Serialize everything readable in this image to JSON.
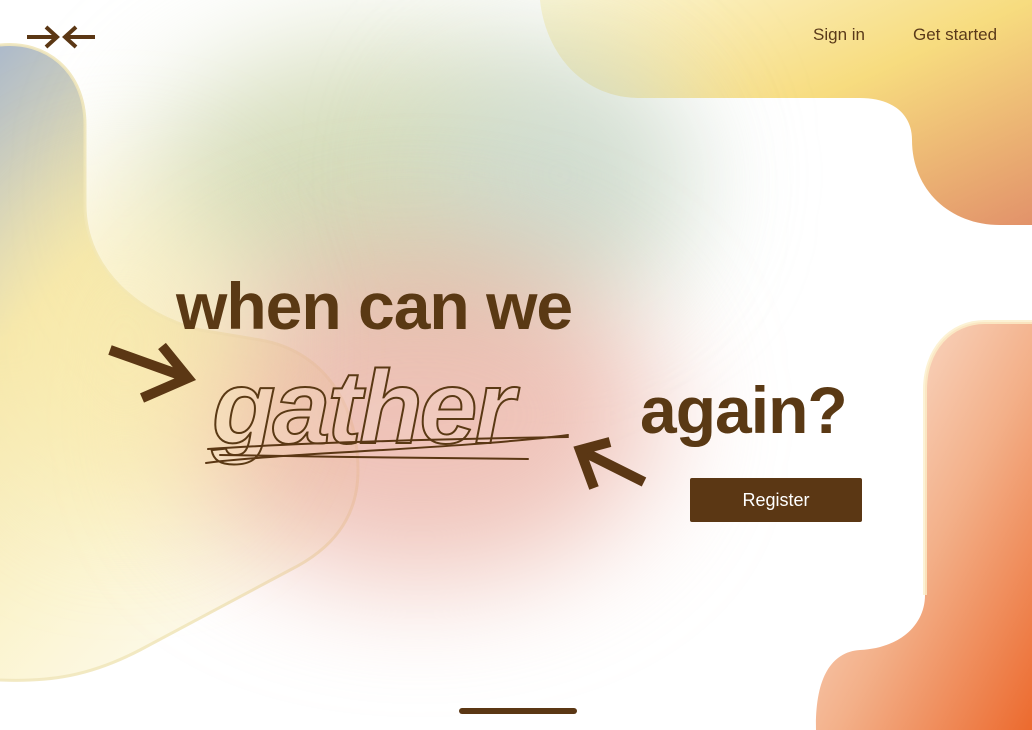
{
  "header": {
    "logo_icon": "arrows-converging-icon",
    "sign_in": "Sign in",
    "get_started": "Get started"
  },
  "hero": {
    "line_1": "when can we",
    "line_2": "gather",
    "line_3": "again?",
    "register": "Register"
  },
  "colors": {
    "brand_brown": "#5b3714",
    "orange": "#ec6c35",
    "yellow": "#f6de86"
  }
}
